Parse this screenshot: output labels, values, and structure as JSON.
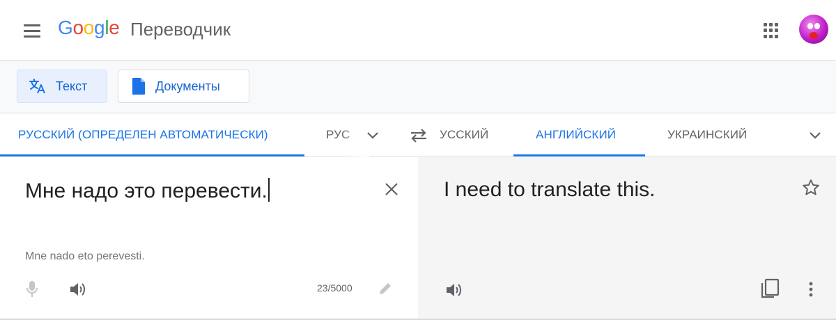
{
  "header": {
    "logo": {
      "g1": "G",
      "o1": "o",
      "o2": "o",
      "g2": "g",
      "l": "l",
      "e": "e"
    },
    "product_name": "Переводчик",
    "menu_icon": "hamburger-menu-icon",
    "apps_icon": "apps-grid-icon"
  },
  "modes": {
    "text_label": "Текст",
    "documents_label": "Документы"
  },
  "languages": {
    "source_detected": "РУССКИЙ (ОПРЕДЕЛЕН АВТОМАТИЧЕСКИ)",
    "source_option_faded": "РУС",
    "source_option_overflow": "УССКИЙ",
    "target_active": "АНГЛИЙСКИЙ",
    "target_option": "УКРАИНСКИЙ"
  },
  "source": {
    "text": "Мне надо это перевести.",
    "transliteration": "Mne nado eto perevesti.",
    "char_count": "23/5000"
  },
  "target": {
    "text": "I need to translate this."
  },
  "colors": {
    "accent": "#1a73e8",
    "target_panel_bg": "#f5f5f5",
    "icon_gray": "#5f6368"
  }
}
